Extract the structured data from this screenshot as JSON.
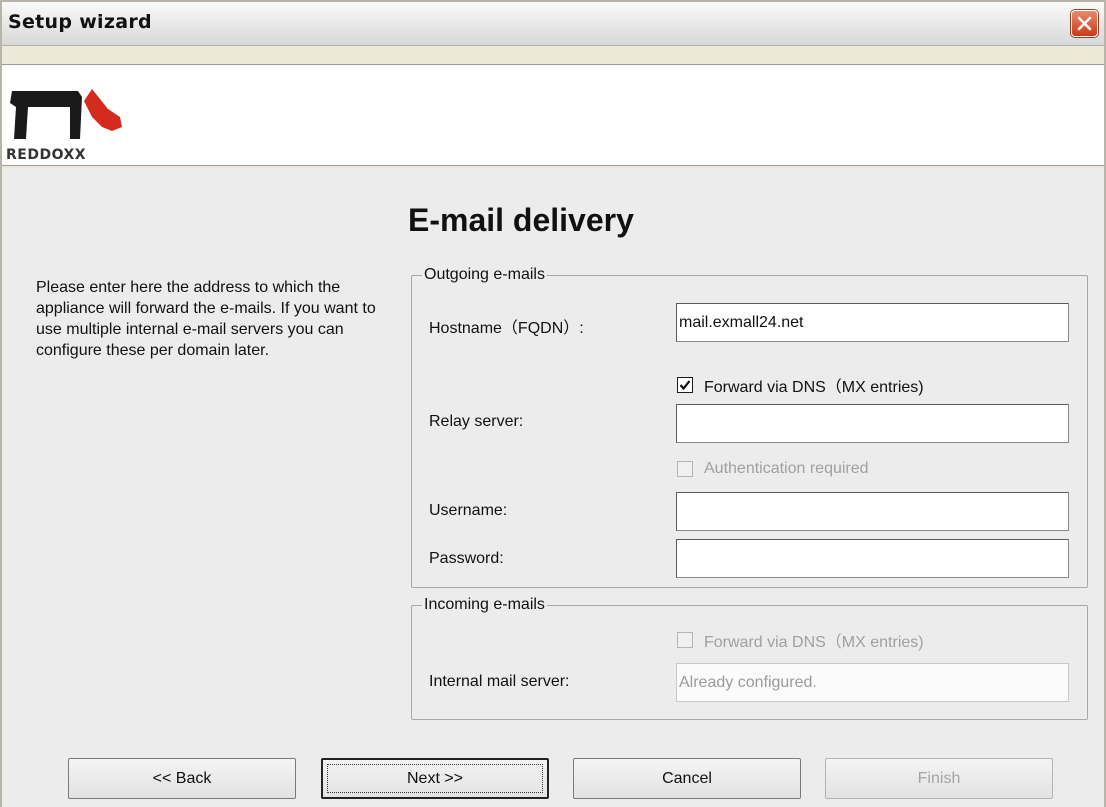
{
  "window": {
    "title": "Setup wizard"
  },
  "brand": {
    "logo_text": "REDDOXX",
    "logo_colors": {
      "dark": "#1a1a1a",
      "accent": "#d42b1e"
    }
  },
  "page": {
    "title": "E-mail delivery",
    "help_text": "Please enter here the address to which the appliance will forward the e-mails. If you want to use multiple internal e-mail servers you can configure these per domain later."
  },
  "outgoing": {
    "legend": "Outgoing e-mails",
    "hostname_label": "Hostname（FQDN）:",
    "hostname_value": "mail.exmall24.net",
    "forward_dns_label": "Forward via DNS（MX entries)",
    "forward_dns_checked": true,
    "relay_label": "Relay server:",
    "relay_value": "",
    "auth_label": "Authentication required",
    "auth_checked": false,
    "username_label": "Username:",
    "username_value": "",
    "password_label": "Password:",
    "password_value": ""
  },
  "incoming": {
    "legend": "Incoming e-mails",
    "forward_dns_label": "Forward via DNS（MX entries)",
    "forward_dns_checked": false,
    "internal_label": "Internal mail server:",
    "internal_value": "Already configured."
  },
  "buttons": {
    "back": "<< Back",
    "next": "Next >>",
    "cancel": "Cancel",
    "finish": "Finish"
  }
}
